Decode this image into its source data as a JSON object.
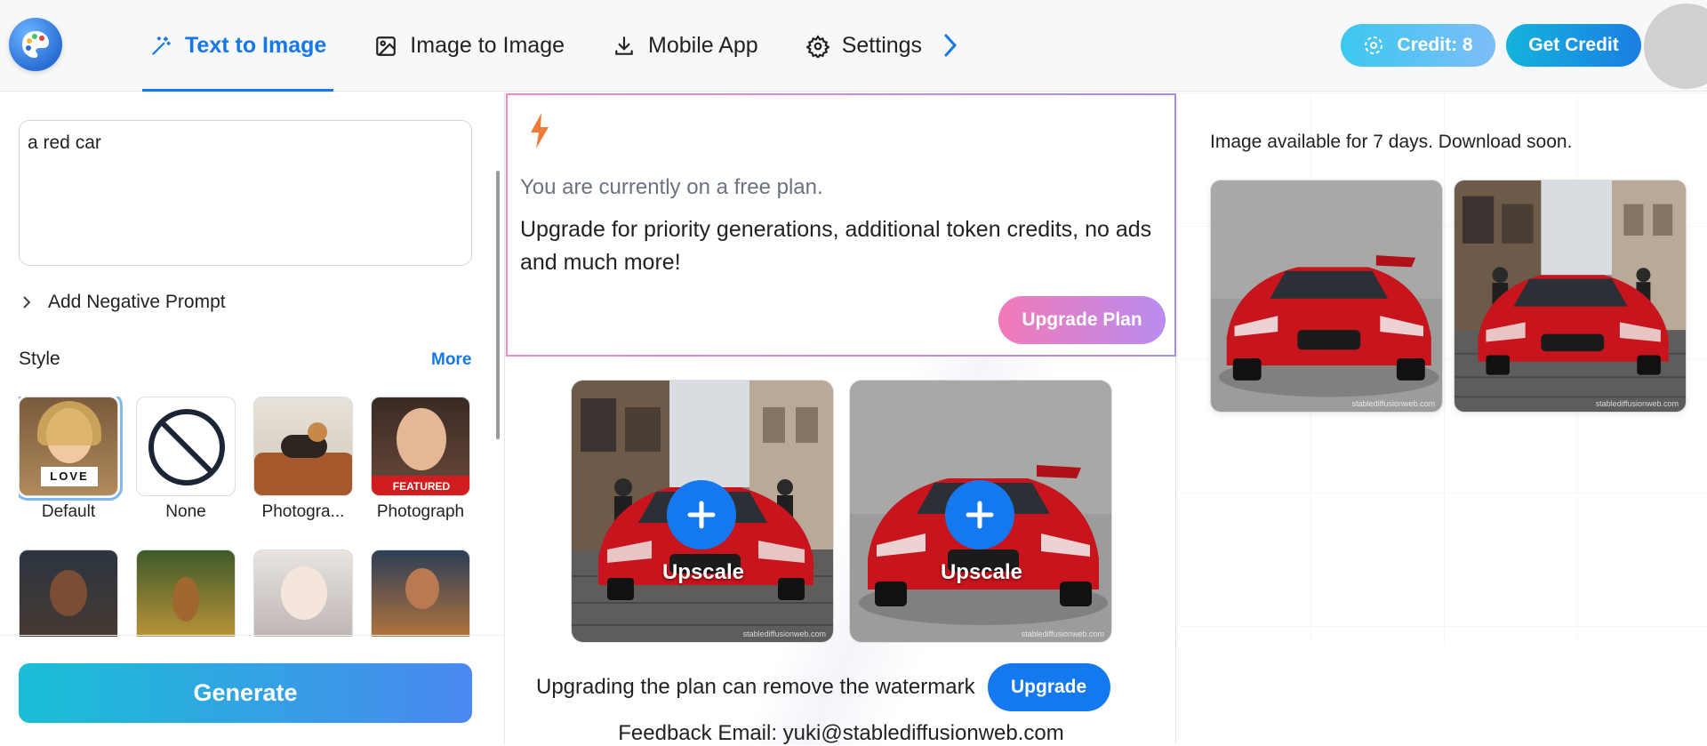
{
  "header": {
    "tabs": [
      {
        "label": "Text to Image",
        "icon": "magic-wand-icon",
        "active": true
      },
      {
        "label": "Image to Image",
        "icon": "image-icon",
        "active": false
      },
      {
        "label": "Mobile App",
        "icon": "download-icon",
        "active": false
      },
      {
        "label": "Settings",
        "icon": "gear-icon",
        "active": false
      }
    ],
    "credit_label": "Credit: 8",
    "get_credit_label": "Get Credit"
  },
  "left": {
    "prompt_value": "a red car",
    "negative_prompt_label": "Add Negative Prompt",
    "style_label": "Style",
    "more_label": "More",
    "styles": [
      {
        "label": "Default",
        "badge": "LOVE",
        "selected": true
      },
      {
        "label": "None",
        "selected": false
      },
      {
        "label": "Photogra...",
        "selected": false
      },
      {
        "label": "Photograph",
        "badge": "FEATURED",
        "selected": false
      }
    ],
    "generate_label": "Generate"
  },
  "center": {
    "free_plan_text": "You are currently on a free plan.",
    "upsell_text": "Upgrade for priority generations, additional token credits, no ads and much more!",
    "upgrade_plan_label": "Upgrade Plan",
    "upscale_label": "Upscale",
    "watermark_note": "Upgrading the plan can remove the watermark",
    "upgrade_label": "Upgrade",
    "feedback_text": "Feedback Email: yuki@stablediffusionweb.com",
    "watermark_text": "stablediffusionweb.com"
  },
  "right": {
    "availability_text": "Image available for 7 days. Download soon."
  },
  "colors": {
    "accent": "#1677e6",
    "upgrade_gradient_start": "#f27ab8",
    "upgrade_gradient_end": "#b98cf0",
    "car_red": "#c8141c"
  }
}
